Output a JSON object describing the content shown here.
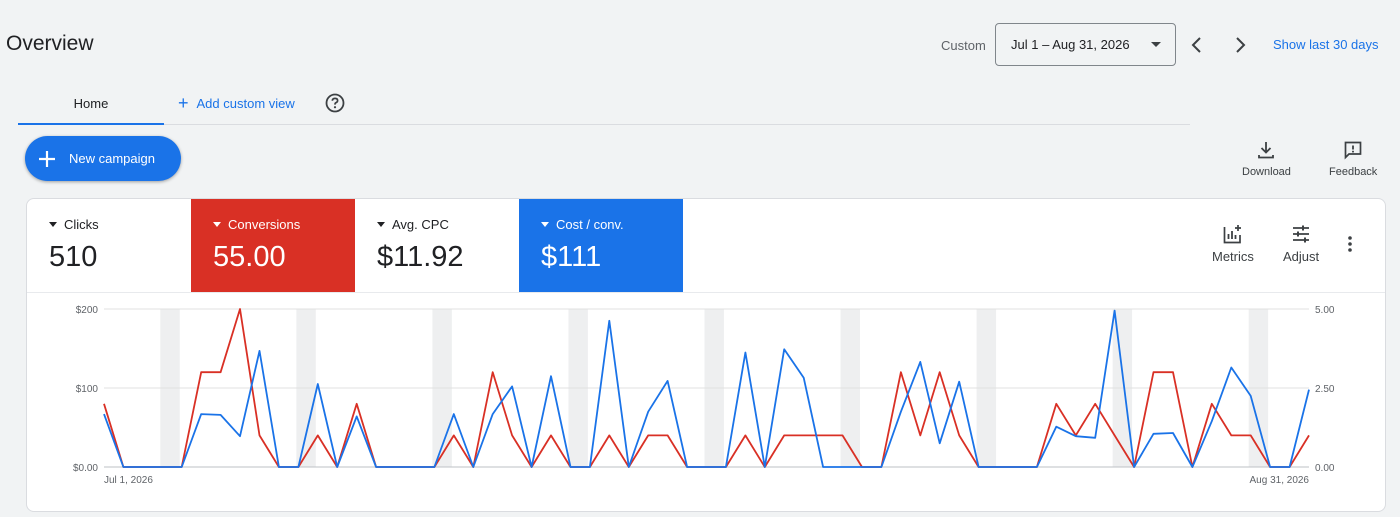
{
  "header": {
    "title": "Overview",
    "date_label": "Custom",
    "date_range": "Jul 1 – Aug 31, 2026",
    "show_last": "Show last 30 days"
  },
  "tabs": {
    "home": "Home",
    "add_custom_view": "Add custom view"
  },
  "actions": {
    "new_campaign": "New campaign",
    "download": "Download",
    "feedback": "Feedback"
  },
  "metrics": [
    {
      "label": "Clicks",
      "value": "510",
      "color": "#ffffff"
    },
    {
      "label": "Conversions",
      "value": "55.00",
      "color": "#d93025"
    },
    {
      "label": "Avg. CPC",
      "value": "$11.92",
      "color": "#ffffff"
    },
    {
      "label": "Cost / conv.",
      "value": "$111",
      "color": "#1a73e8"
    }
  ],
  "card_tools": {
    "metrics": "Metrics",
    "adjust": "Adjust"
  },
  "chart_data": {
    "type": "line",
    "x_start_label": "Jul 1, 2026",
    "x_end_label": "Aug 31, 2026",
    "y_left_ticks": [
      "$0.00",
      "$100",
      "$200"
    ],
    "y_left_range": [
      0,
      200
    ],
    "y_right_ticks": [
      "0.00",
      "2.50",
      "5.00"
    ],
    "y_right_range": [
      0,
      5
    ],
    "weekend_bands_start_index": [
      3,
      10,
      17,
      24,
      31,
      38,
      45,
      52,
      59
    ],
    "series": [
      {
        "name": "Conversions",
        "color": "#d93025",
        "axis": "right",
        "values": [
          2,
          0,
          0,
          0,
          0,
          3,
          3,
          5,
          1,
          0,
          0,
          1,
          0,
          2,
          0,
          0,
          0,
          0,
          1,
          0,
          3,
          1,
          0,
          1,
          0,
          0,
          1,
          0,
          1,
          1,
          0,
          0,
          0,
          1,
          0,
          1,
          1,
          1,
          1,
          0,
          0,
          3,
          1,
          3,
          1,
          0,
          0,
          0,
          0,
          2,
          1,
          2,
          1,
          0,
          3,
          3,
          0,
          2,
          1,
          1,
          0,
          0,
          1
        ]
      },
      {
        "name": "Cost / conv.",
        "color": "#1a73e8",
        "axis": "left",
        "values": [
          67,
          0,
          0,
          0,
          0,
          67,
          66,
          39,
          147,
          0,
          0,
          105,
          0,
          64,
          0,
          0,
          0,
          0,
          67,
          0,
          67,
          102,
          0,
          115,
          0,
          0,
          185,
          0,
          70,
          109,
          0,
          0,
          0,
          145,
          0,
          149,
          113,
          0,
          0,
          0,
          0,
          70,
          133,
          30,
          108,
          0,
          0,
          0,
          0,
          51,
          39,
          37,
          198,
          0,
          42,
          43,
          0,
          58,
          126,
          90,
          0,
          0,
          98
        ]
      }
    ]
  }
}
